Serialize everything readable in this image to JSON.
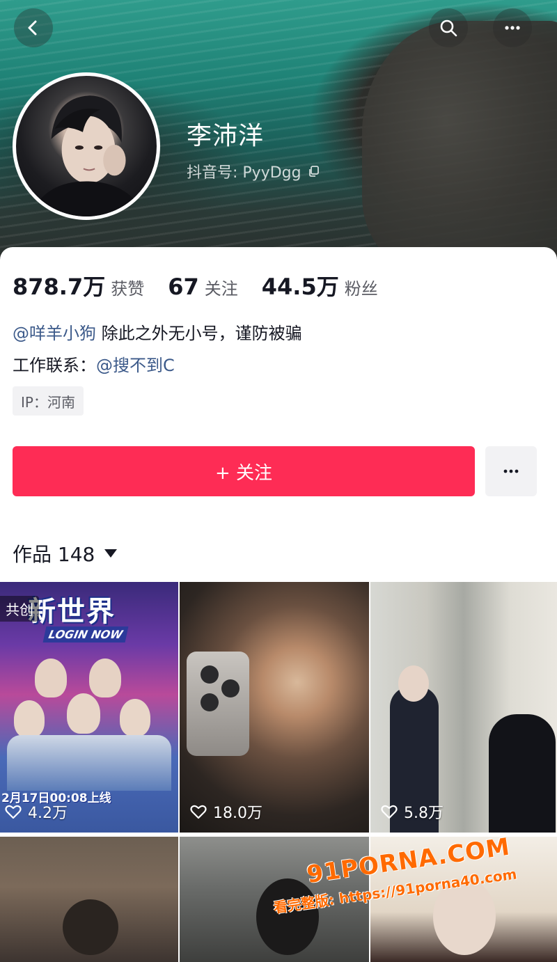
{
  "profile": {
    "nickname": "李沛洋",
    "douyin_id": "抖音号: PyyDgg"
  },
  "stats": [
    {
      "value": "878.7万",
      "label": "获赞"
    },
    {
      "value": "67",
      "label": "关注"
    },
    {
      "value": "44.5万",
      "label": "粉丝"
    }
  ],
  "bio": {
    "line1_mention": "@咩羊小狗",
    "line1_text": " 除此之外无小号，谨防被骗",
    "line2_text": "工作联系：",
    "line2_mention": "@搜不到C"
  },
  "ip_label": "IP：河南",
  "actions": {
    "follow_label": "+ 关注",
    "more_label": "···"
  },
  "works": {
    "title": "作品 148"
  },
  "videos": [
    {
      "likes": "4.2万",
      "tag": "共创",
      "poster_title": "新世界",
      "poster_sub": "LOGIN NOW",
      "poster_date": "2月17日00:08上线"
    },
    {
      "likes": "18.0万"
    },
    {
      "likes": "5.8万"
    },
    {
      "likes": ""
    },
    {
      "likes": ""
    },
    {
      "likes": ""
    }
  ],
  "watermark": {
    "top": "91PORNA.COM",
    "bottom": "看完整版: https://91porna40.com"
  },
  "colors": {
    "accent": "#fe2c55",
    "mention": "#3c5a8a"
  }
}
